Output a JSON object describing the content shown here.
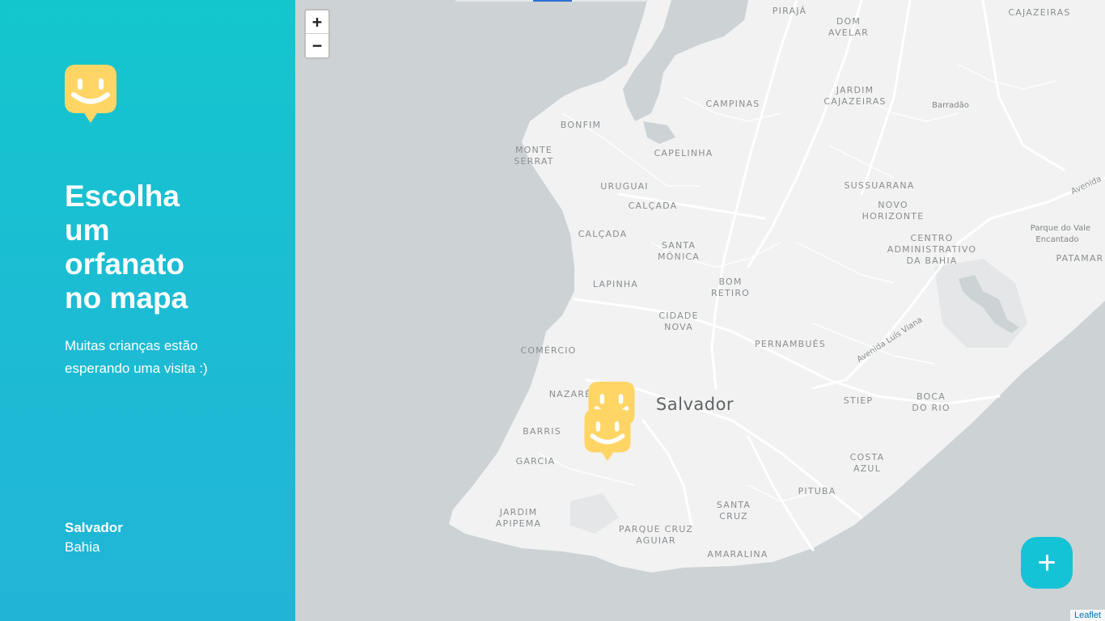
{
  "sidebar": {
    "logo_icon": "happy-face-pin-icon",
    "title_lines": [
      "Escolha",
      "um",
      "orfanato",
      "no mapa"
    ],
    "subtitle": "Muitas crianças estão esperando uma visita :)",
    "location": {
      "city": "Salvador",
      "state": "Bahia"
    },
    "colors": {
      "gradient_start": "#13c6cd",
      "gradient_end": "#22b4d6",
      "logo": "#ffd666"
    }
  },
  "map": {
    "zoom_in_label": "+",
    "zoom_out_label": "−",
    "city_label": "Salvador",
    "neighborhoods": {
      "piraja": "PIRAJÁ",
      "dom_avelar_1": "DOM",
      "dom_avelar_2": "AVELAR",
      "cajazeiras": "CAJAZEIRAS",
      "campinas": "CAMPINAS",
      "jardim_cajazeiras_1": "JARDIM",
      "jardim_cajazeiras_2": "CAJAZEIRAS",
      "barradao": "Barradão",
      "bonfim": "BONFIM",
      "monte_serrat_1": "MONTE",
      "monte_serrat_2": "SERRAT",
      "capelinha": "CAPELINHA",
      "uruguai": "URUGUAI",
      "sussuarana": "SUSSUARANA",
      "calcada_1": "CALÇADA",
      "calcada_2": "CALÇADA",
      "novo_horizonte_1": "NOVO",
      "novo_horizonte_2": "HORIZONTE",
      "avenida_1": "Avenida",
      "parque_vale_1": "Parque do Vale",
      "parque_vale_2": "Encantado",
      "cab_1": "CENTRO",
      "cab_2": "ADMINISTRATIVO",
      "cab_3": "DA BAHIA",
      "pataman": "PATAMAR",
      "santa_monica_1": "SANTA",
      "santa_monica_2": "MÔNICA",
      "lapinha": "LAPINHA",
      "bom_retiro_1": "BOM",
      "bom_retiro_2": "RETIRO",
      "cidade_nova_1": "CIDADE",
      "cidade_nova_2": "NOVA",
      "avenida_luis_viana": "Avenida Luís Viana",
      "comercio": "COMÉRCIO",
      "pernambues": "PERNAMBUÉS",
      "nazare": "NAZARÉ",
      "stiep": "STIEP",
      "boca_rio_1": "BOCA",
      "boca_rio_2": "DO RIO",
      "barris": "BARRIS",
      "garcia": "GARCIA",
      "costa_azul_1": "COSTA",
      "costa_azul_2": "AZUL",
      "pituba": "PITUBA",
      "jardim_apipema_1": "JARDIM",
      "jardim_apipema_2": "APIPEMA",
      "santa_cruz_1": "SANTA",
      "santa_cruz_2": "CRUZ",
      "parque_cruz_aguiar_1": "PARQUE CRUZ",
      "parque_cruz_aguiar_2": "AGUIAR",
      "amaralina": "AMARALINA"
    },
    "marker_icon": "happy-face-pin-icon",
    "attribution": "Leaflet",
    "colors": {
      "water": "#cdd2d4",
      "land": "#f2f2f2",
      "marker": "#ffd666"
    }
  },
  "create_button": {
    "icon": "plus-icon",
    "color": "#15c3d6"
  }
}
